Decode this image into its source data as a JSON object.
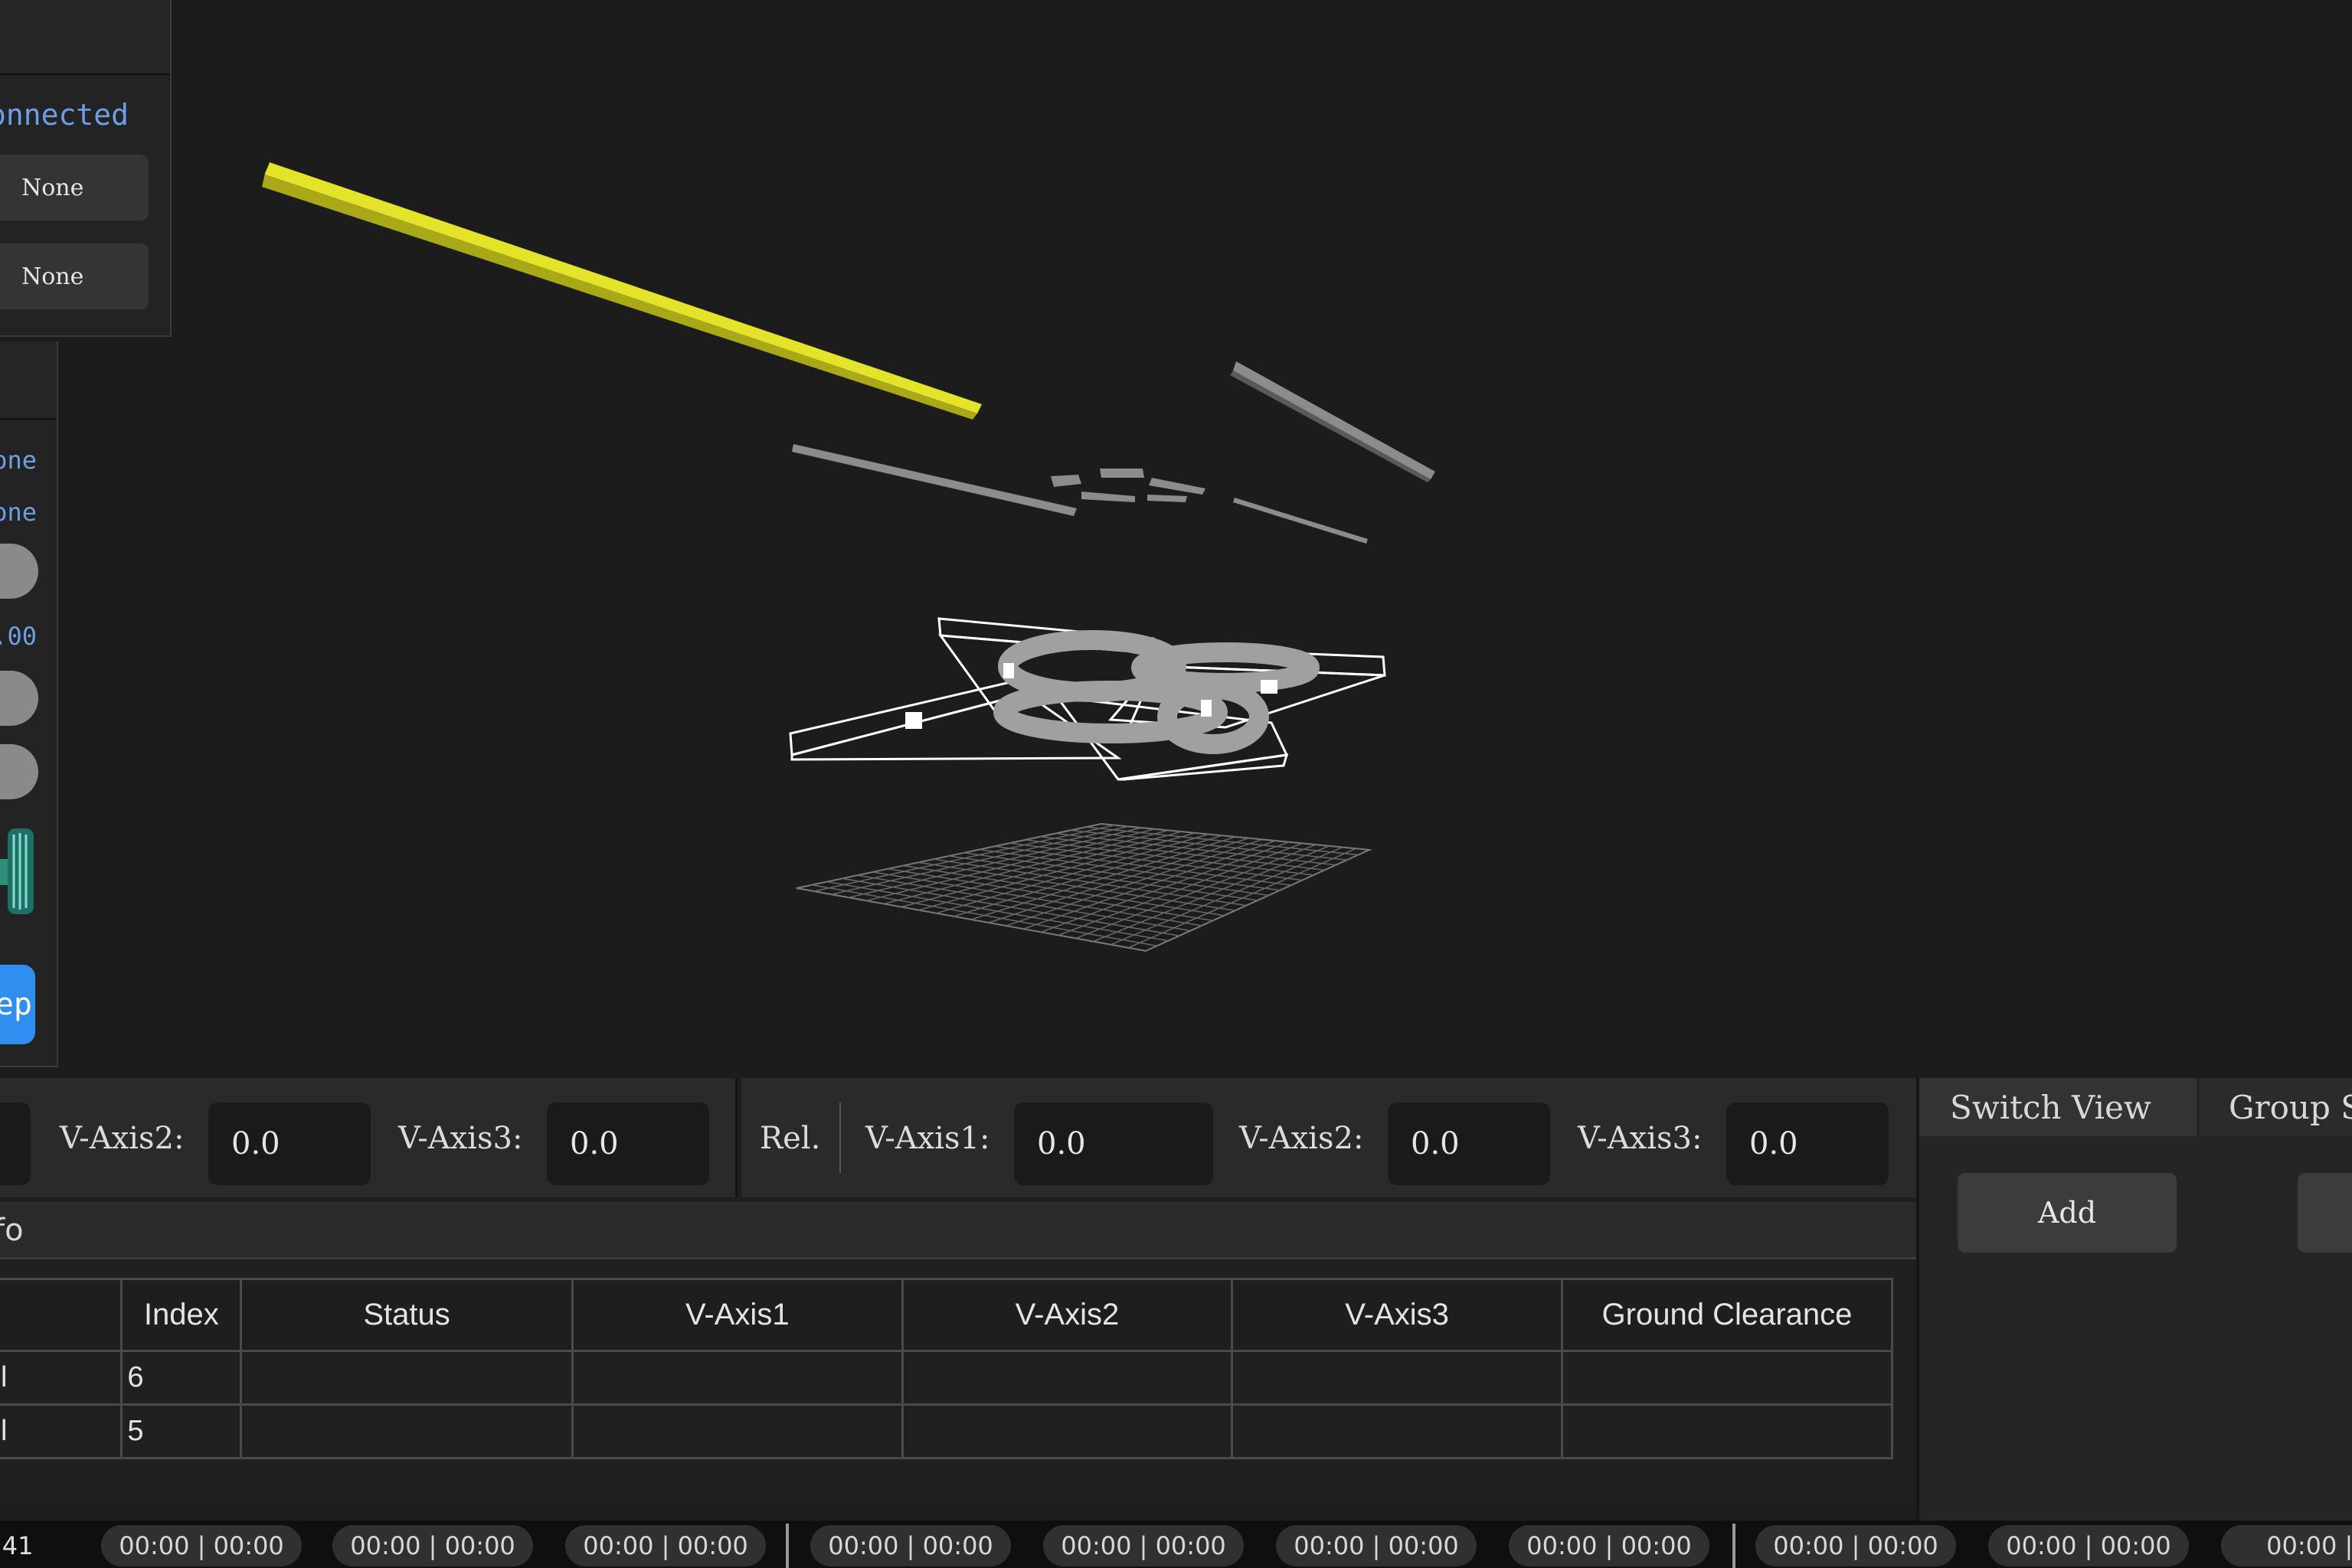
{
  "left_panel": {
    "status": "onnected",
    "button_1": "None",
    "button_2": "None"
  },
  "left_panel_2": {
    "text_1": "one",
    "text_2": "one",
    "text_3": ".00",
    "step_button": "ep"
  },
  "axis_abs": {
    "axis2_label": "V-Axis2:",
    "axis2_value": "0.0",
    "axis3_label": "V-Axis3:",
    "axis3_value": "0.0"
  },
  "axis_rel": {
    "rel_label": "Rel.",
    "axis1_label": "V-Axis1:",
    "axis1_value": "0.0",
    "axis2_label": "V-Axis2:",
    "axis2_value": "0.0",
    "axis3_label": "V-Axis3:",
    "axis3_value": "0.0"
  },
  "info": {
    "title": "fo"
  },
  "table": {
    "headers": [
      "",
      "Index",
      "Status",
      "V-Axis1",
      "V-Axis2",
      "V-Axis3",
      "Ground Clearance"
    ],
    "rows": [
      [
        "l",
        "6",
        "",
        "",
        "",
        "",
        ""
      ],
      [
        "l",
        "5",
        "",
        "",
        "",
        "",
        ""
      ]
    ]
  },
  "side_panel": {
    "tab_active": "Switch View",
    "tab_other": "Group S",
    "add_button": "Add"
  },
  "timeline": {
    "current_time": ":41",
    "segments": [
      "00:00 | 00:00",
      "00:00 | 00:00",
      "00:00 | 00:00",
      "00:00 | 00:00",
      "00:00 | 00:00",
      "00:00 | 00:00",
      "00:00 | 00:00",
      "00:00 | 00:00",
      "00:00 | 00:00",
      "00:00 | 0"
    ]
  },
  "colors": {
    "accent_blue": "#6b9fe6",
    "step_button": "#2f8ef0",
    "highlight_bar": "#d8d820"
  }
}
